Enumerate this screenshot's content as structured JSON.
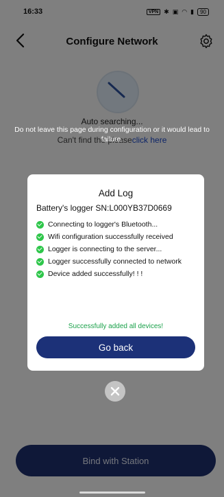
{
  "status_bar": {
    "time": "16:33",
    "vpn_label": "VPN",
    "icons": [
      "bluetooth-icon",
      "nfc-icon",
      "wifi-icon",
      "signal-icon"
    ],
    "battery": "90"
  },
  "header": {
    "title": "Configure Network",
    "back_icon": "chevron-left-icon",
    "settings_icon": "gear-icon"
  },
  "background": {
    "auto_searching": "Auto searching...",
    "cant_find": "Can't find the",
    "cant_find_tail": "please",
    "click_here": "click here",
    "warning": "Do not leave this page during configuration or it would lead to failure.",
    "bind_button": "Bind with Station"
  },
  "dialog": {
    "title": "Add Log",
    "device": "Battery's logger  SN:L000YB37D0669",
    "steps": [
      "Connecting to logger's Bluetooth...",
      "Wifi configuration successfully received",
      "Logger is connecting to the server...",
      "Logger successfully connected to network",
      "Device added successfully!  !  !"
    ],
    "success_message": "Successfully added all devices!",
    "go_back_button": "Go back"
  },
  "colors": {
    "primary": "#1c3178",
    "success": "#1aa14a",
    "check": "#2ec64a",
    "link": "#1a47c7"
  }
}
